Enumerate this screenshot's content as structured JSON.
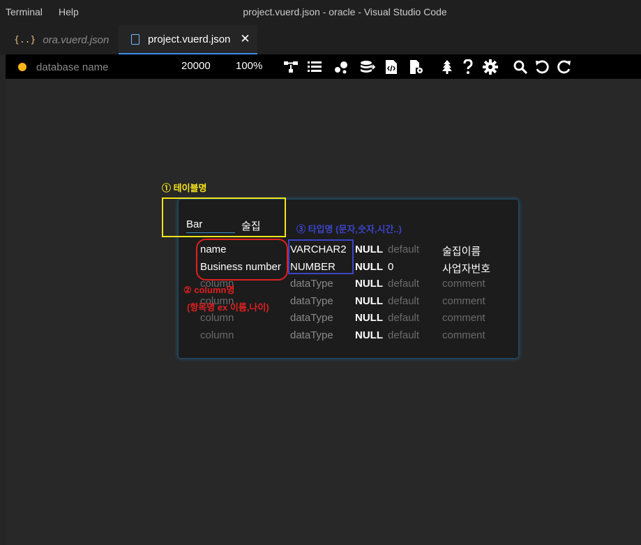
{
  "titlebar": {
    "menu": [
      "Terminal",
      "Help"
    ],
    "window_title": "project.vuerd.json - oracle - Visual Studio Code"
  },
  "tabs": [
    {
      "icon": "{..}",
      "label": "ora.vuerd.json",
      "active": false
    },
    {
      "icon": "file-icon",
      "label": "project.vuerd.json",
      "active": true,
      "close": "✕"
    }
  ],
  "toolbar": {
    "database_placeholder": "database name",
    "canvas_size": "20000",
    "zoom": "100%",
    "icons": [
      "relationship-icon",
      "list-icon",
      "visualization-icon",
      "database-import-icon",
      "sql-export-icon",
      "settings-file-icon",
      "tree-icon",
      "help-icon",
      "gear-icon",
      "search-icon",
      "undo-icon",
      "redo-icon"
    ],
    "accent": "#f9b61a"
  },
  "table": {
    "name": "Bar",
    "comment": "술집",
    "columns": [
      {
        "name": "name",
        "type": "VARCHAR2",
        "null": "NULL",
        "default": "default",
        "comment": "술집이름",
        "filled": true
      },
      {
        "name": "Business number",
        "type": "NUMBER",
        "null": "NULL",
        "default": "0",
        "comment": "사업자번호",
        "filled": true
      },
      {
        "name": "column",
        "type": "dataType",
        "null": "NULL",
        "default": "default",
        "comment": "comment",
        "filled": false
      },
      {
        "name": "column",
        "type": "dataType",
        "null": "NULL",
        "default": "default",
        "comment": "comment",
        "filled": false
      },
      {
        "name": "column",
        "type": "dataType",
        "null": "NULL",
        "default": "default",
        "comment": "comment",
        "filled": false
      },
      {
        "name": "column",
        "type": "dataType",
        "null": "NULL",
        "default": "default",
        "comment": "comment",
        "filled": false
      }
    ]
  },
  "annotations": {
    "table_name": {
      "label": "① 테이블명",
      "color": "#f5e31a"
    },
    "column_name": {
      "label": "② column명",
      "sublabel": "(항목명 ex 이름,나이)",
      "color": "#e02020"
    },
    "type_name": {
      "label": "③ 타입명 (문자,숫자,시간..)",
      "color": "#3c44c8"
    }
  }
}
